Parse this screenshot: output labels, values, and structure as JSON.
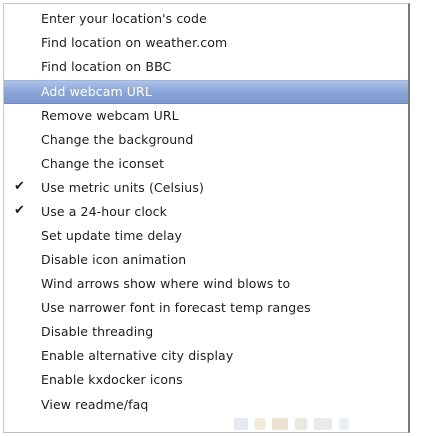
{
  "menu": {
    "items": [
      {
        "label": "Enter your location's code",
        "checked": false,
        "highlighted": false
      },
      {
        "label": "Find location on weather.com",
        "checked": false,
        "highlighted": false
      },
      {
        "label": "Find location on BBC",
        "checked": false,
        "highlighted": false
      },
      {
        "label": "Add webcam URL",
        "checked": false,
        "highlighted": true
      },
      {
        "label": "Remove webcam URL",
        "checked": false,
        "highlighted": false
      },
      {
        "label": "Change the background",
        "checked": false,
        "highlighted": false
      },
      {
        "label": "Change the iconset",
        "checked": false,
        "highlighted": false
      },
      {
        "label": "Use metric units (Celsius)",
        "checked": true,
        "highlighted": false
      },
      {
        "label": "Use a 24-hour clock",
        "checked": true,
        "highlighted": false
      },
      {
        "label": "Set update time delay",
        "checked": false,
        "highlighted": false
      },
      {
        "label": "Disable icon animation",
        "checked": false,
        "highlighted": false
      },
      {
        "label": "Wind arrows show where wind blows to",
        "checked": false,
        "highlighted": false
      },
      {
        "label": "Use narrower font in forecast temp ranges",
        "checked": false,
        "highlighted": false
      },
      {
        "label": "Disable threading",
        "checked": false,
        "highlighted": false
      },
      {
        "label": "Enable alternative city display",
        "checked": false,
        "highlighted": false
      },
      {
        "label": "Enable kxdocker icons",
        "checked": false,
        "highlighted": false
      },
      {
        "label": "View readme/faq",
        "checked": false,
        "highlighted": false
      }
    ],
    "check_glyph": "✔",
    "highlight_color": "#8aa5d8"
  }
}
